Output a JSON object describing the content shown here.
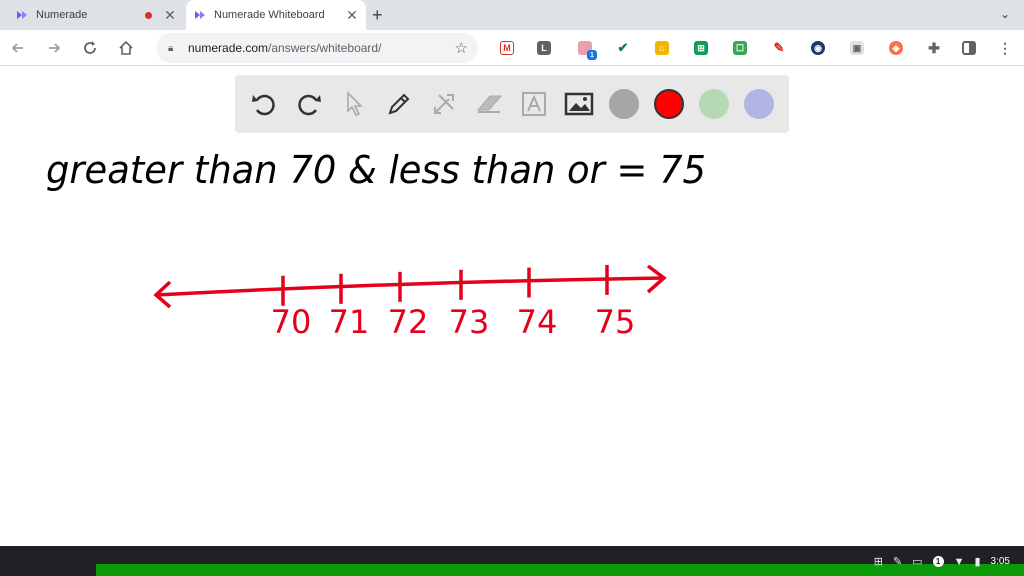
{
  "browser": {
    "tabs": [
      {
        "title": "Numerade",
        "recording": true
      },
      {
        "title": "Numerade Whiteboard",
        "active": true
      }
    ],
    "new_tab_glyph": "+",
    "address": {
      "host": "numerade.com",
      "path": "/answers/whiteboard/"
    },
    "extensions": [
      "gmail-icon",
      "l-extension-icon",
      "notification-extension-icon",
      "check-extension-icon",
      "home-extension-icon",
      "grid-extension-icon",
      "screen-extension-icon",
      "pen-extension-icon",
      "globe-extension-icon",
      "image-extension-icon",
      "fish-extension-icon",
      "puzzle-icon",
      "sidepanel-icon",
      "menu-icon"
    ],
    "badge_count": "1"
  },
  "whiteboard": {
    "tools": [
      "undo-icon",
      "redo-icon",
      "select-pointer-icon",
      "pen-icon",
      "tools-icon",
      "eraser-icon",
      "text-icon",
      "image-icon"
    ],
    "colors": [
      "#a6a6a6",
      "#ff0000",
      "#b4d9b4",
      "#b3b3e6"
    ],
    "handwriting": {
      "line1": "greater than 70 & less than or = 75"
    },
    "number_line": {
      "labels": [
        "70",
        "71",
        "72",
        "73",
        "74",
        "75"
      ],
      "color": "#e4001b"
    }
  },
  "shelf": {
    "time": "3:05",
    "notification_count": "1"
  }
}
